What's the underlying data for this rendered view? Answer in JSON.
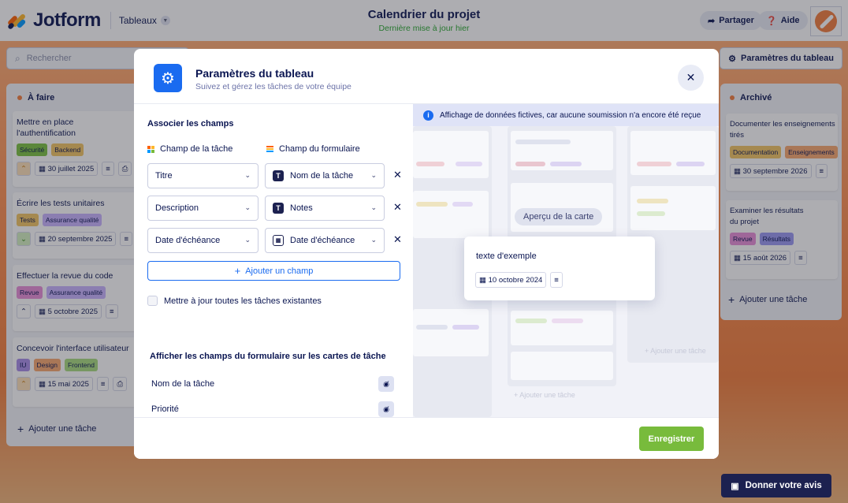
{
  "app": {
    "brand": "Jotform",
    "tables_label": "Tableaux",
    "title": "Calendrier du projet",
    "subtitle": "Dernière mise à jour hier"
  },
  "header": {
    "share_label": "Partager",
    "help_label": "Aide"
  },
  "toolbar": {
    "search_placeholder": "Rechercher",
    "board_settings_label": "Paramètres du tableau"
  },
  "columns": [
    {
      "title": "À faire",
      "dot_color": "#f27c3c",
      "add_label": "Ajouter une tâche",
      "cards": [
        {
          "title": "Mettre en place l'authentification",
          "tags": [
            "Sécurité",
            "Backend"
          ],
          "date": "30 juillet 2025"
        },
        {
          "title": "Écrire les tests unitaires",
          "tags": [
            "Tests",
            "Assurance qualité"
          ],
          "date": "20 septembre 2025"
        },
        {
          "title": "Effectuer la revue du code",
          "tags": [
            "Revue",
            "Assurance qualité"
          ],
          "date": "5 octobre 2025"
        },
        {
          "title": "Concevoir l'interface utilisateur",
          "tags": [
            "IU",
            "Design",
            "Frontend"
          ],
          "date": "15 mai 2025"
        }
      ]
    },
    {
      "title": "Archivé",
      "dot_color": "#f27c3c",
      "add_label": "Ajouter une tâche",
      "cards": [
        {
          "title": "Documenter les enseignements tirés",
          "tags": [
            "Documentation",
            "Enseignements"
          ],
          "date": "30 septembre 2026"
        },
        {
          "title": "Examiner les résultats du projet",
          "tags": [
            "Revue",
            "Résultats"
          ],
          "date": "15 août 2026"
        }
      ]
    }
  ],
  "modal": {
    "title": "Paramètres du tableau",
    "subtitle": "Suivez et gérez les tâches de votre équipe",
    "mapping": {
      "section_title": "Associer les champs",
      "task_field_header": "Champ de la tâche",
      "form_field_header": "Champ du formulaire",
      "rows": [
        {
          "task_field": "Titre",
          "form_field": "Nom de la tâche",
          "form_icon": "text-icon"
        },
        {
          "task_field": "Description",
          "form_field": "Notes",
          "form_icon": "text-icon"
        },
        {
          "task_field": "Date d'échéance",
          "form_field": "Date d'échéance",
          "form_icon": "calendar-icon"
        }
      ],
      "add_field_label": "Ajouter un champ",
      "update_all_label": "Mettre à jour toutes les tâches existantes"
    },
    "display": {
      "section_title": "Afficher les champs du formulaire sur les cartes de tâche",
      "fields": [
        "Nom de la tâche",
        "Priorité"
      ]
    },
    "preview": {
      "info_text": "Affichage de données fictives, car aucune soumission n'a encore été reçue",
      "pill_label": "Aperçu de la carte",
      "card_title": "texte d'exemple",
      "card_date": "10 octobre 2024",
      "ghost_add_labels": [
        "Ajouter une tâche",
        "Ajouter une tâche"
      ]
    },
    "save_label": "Enregistrer"
  },
  "feedback_label": "Donner votre avis",
  "tag_colors": {
    "Sécurité": "#7bc241",
    "Backend": "#f3c663",
    "Tests": "#f3c663",
    "Assurance qualité": "#c9b3ff",
    "Revue": "#e98ed9",
    "IU": "#a98de8",
    "Design": "#f9a86f",
    "Frontend": "#a9dc7e",
    "Documentation": "#f3c663",
    "Enseignements": "#f9a86f",
    "Résultats": "#9a98f2"
  }
}
